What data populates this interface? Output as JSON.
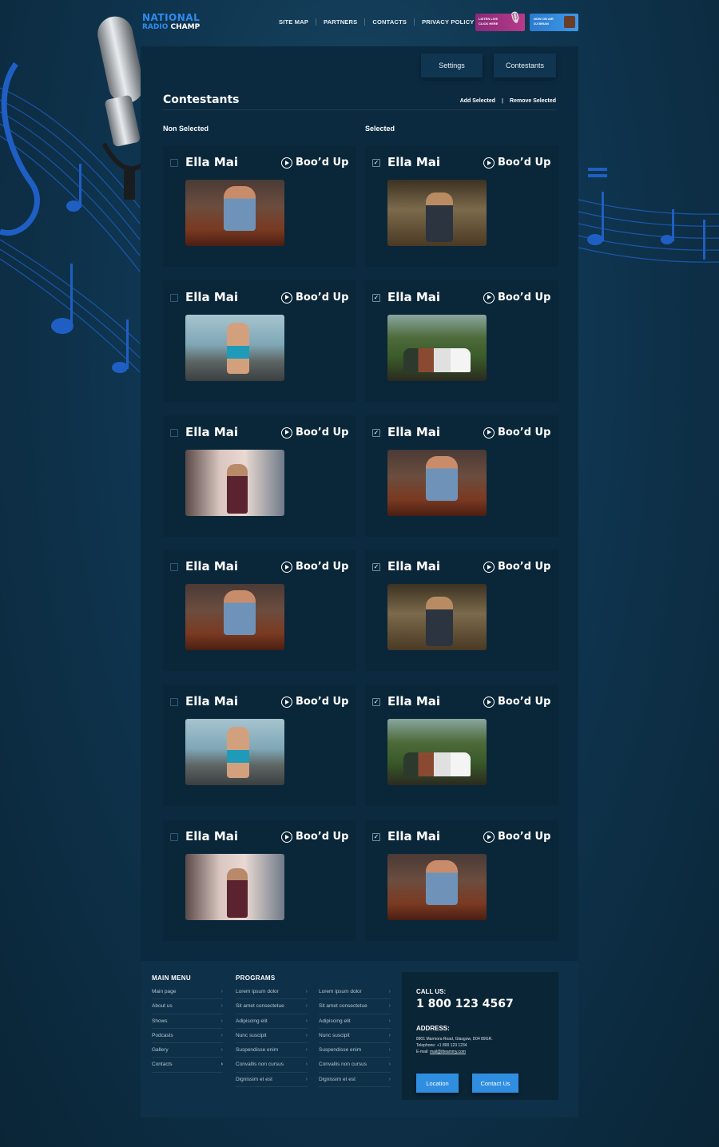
{
  "brand": {
    "line1": "NATIONAL",
    "line2_a": "RADIO",
    "line2_b": " CHAMP"
  },
  "nav": [
    "SITE MAP",
    "PARTNERS",
    "CONTACTS",
    "PRIVACY POLICY"
  ],
  "badges": {
    "live": {
      "title": "LISTEN LIVE",
      "sub": "CLICK HERE"
    },
    "air": {
      "title": "NOW ON AIR",
      "sub": "DJ BRIAN"
    }
  },
  "tabs": {
    "settings": "Settings",
    "contestants": "Contestants"
  },
  "panel": {
    "title": "Contestants",
    "add_selected": "Add Selected",
    "separator": "|",
    "remove_selected": "Remove Selected",
    "col_left": "Non Selected",
    "col_right": "Selected"
  },
  "cards_left": [
    {
      "name": "Ella Mai",
      "tag": "Boo’d Up",
      "checked": false
    },
    {
      "name": "Ella Mai",
      "tag": "Boo’d Up",
      "checked": false
    },
    {
      "name": "Ella Mai",
      "tag": "Boo’d Up",
      "checked": false
    },
    {
      "name": "Ella Mai",
      "tag": "Boo’d Up",
      "checked": false
    },
    {
      "name": "Ella Mai",
      "tag": "Boo’d Up",
      "checked": false
    },
    {
      "name": "Ella Mai",
      "tag": "Boo’d Up",
      "checked": false
    }
  ],
  "cards_right": [
    {
      "name": "Ella Mai",
      "tag": "Boo’d Up",
      "checked": true
    },
    {
      "name": "Ella Mai",
      "tag": "Boo’d Up",
      "checked": true
    },
    {
      "name": "Ella Mai",
      "tag": "Boo’d Up",
      "checked": true
    },
    {
      "name": "Ella Mai",
      "tag": "Boo’d Up",
      "checked": true
    },
    {
      "name": "Ella Mai",
      "tag": "Boo’d Up",
      "checked": true
    },
    {
      "name": "Ella Mai",
      "tag": "Boo’d Up",
      "checked": true
    }
  ],
  "check_mark": "✓",
  "footer": {
    "main_menu_title": "MAIN MENU",
    "programs_title": "PROGRAMS",
    "main_menu": [
      "Main page",
      "About us",
      "Shows",
      "Podcasts",
      "Gallery",
      "Contacts"
    ],
    "programs_a": [
      "Lorem ipsum dolor",
      "Sit amet consectetue",
      "Adipiscing elit",
      "Nunc suscipit",
      "Suspendisse enim",
      "Convallis non cursus",
      "Dignissim et est"
    ],
    "programs_b": [
      "Lorem ipsum dolor",
      "Sit amet consectetue",
      "Adipiscing elit",
      "Nunc suscipit",
      "Suspendisse enim",
      "Convallis non cursus",
      "Dignissim et est"
    ],
    "chevron": "›",
    "call_label": "CALL US:",
    "phone": "1 800 123 4567",
    "address_label": "ADDRESS:",
    "address": "8901 Marmora Road, Glasgow, D04 89GR.",
    "telephone": "Telephone: +1 800 123 1234",
    "email_prefix": "E-mail: ",
    "email": "mail@itteammy.com",
    "btn_location": "Location",
    "btn_contact": "Contact Us"
  },
  "colors": {
    "accent": "#2f8ee0",
    "panel": "#0b2a40",
    "card": "#0a2639",
    "live_badge": "#b83a8a"
  }
}
